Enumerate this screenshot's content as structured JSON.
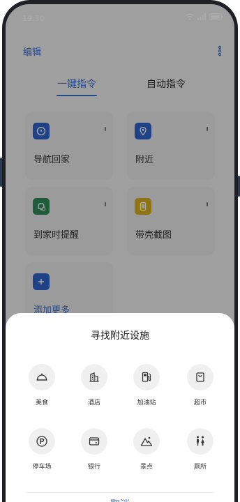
{
  "status_bar": {
    "time": "19:30"
  },
  "header": {
    "edit_label": "编辑"
  },
  "tabs": [
    {
      "label": "一键指令",
      "active": true
    },
    {
      "label": "自动指令",
      "active": false
    }
  ],
  "commands": [
    {
      "label": "导航回家",
      "icon": "compass-icon",
      "icon_bg": "#2f63c8"
    },
    {
      "label": "附近",
      "icon": "location-pin-icon",
      "icon_bg": "#2f63c8"
    },
    {
      "label": "到家时提醒",
      "icon": "bell-clock-icon",
      "icon_bg": "#2f8a5a"
    },
    {
      "label": "带壳截图",
      "icon": "phone-screenshot-icon",
      "icon_bg": "#d6b11b"
    }
  ],
  "add_more": {
    "label": "添加更多"
  },
  "sheet": {
    "title": "寻找附近设施",
    "facilities": [
      {
        "label": "美食",
        "icon": "food-cloche-icon"
      },
      {
        "label": "酒店",
        "icon": "hotel-building-icon"
      },
      {
        "label": "加油站",
        "icon": "gas-pump-icon"
      },
      {
        "label": "超市",
        "icon": "shopping-bag-icon"
      },
      {
        "label": "停车场",
        "icon": "parking-icon"
      },
      {
        "label": "银行",
        "icon": "wallet-card-icon"
      },
      {
        "label": "景点",
        "icon": "mountain-icon"
      },
      {
        "label": "厕所",
        "icon": "restroom-icon"
      }
    ],
    "cancel_label": "取消"
  },
  "colors": {
    "accent": "#3b6cc9",
    "overlay": "rgba(0,0,0,0.33)"
  }
}
